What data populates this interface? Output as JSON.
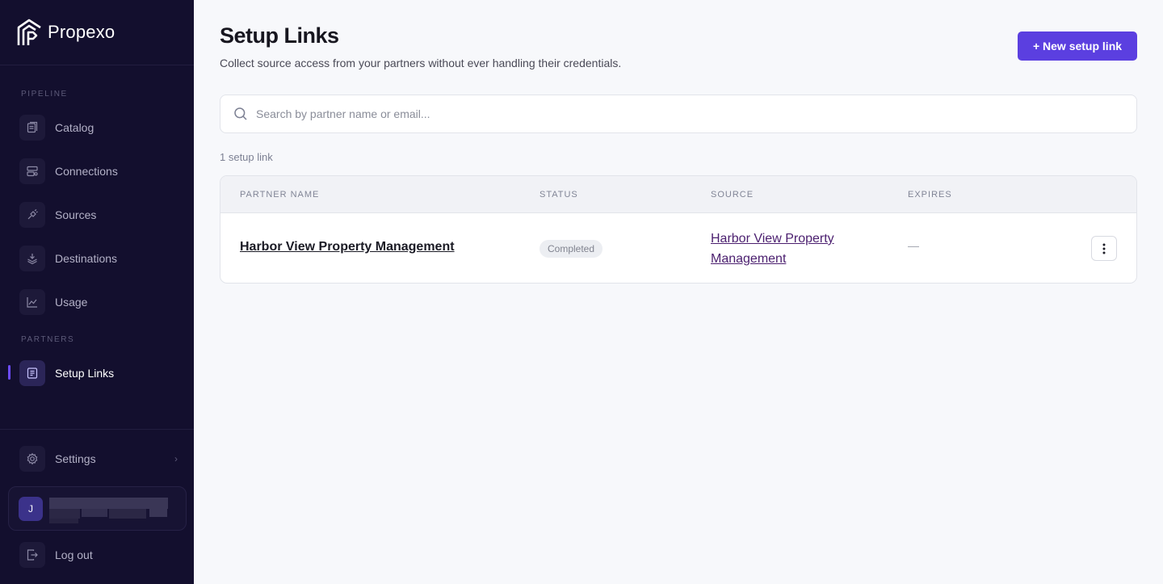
{
  "brand": {
    "name": "Propexo"
  },
  "sidebar": {
    "pipeline_label": "PIPELINE",
    "partners_label": "PARTNERS",
    "items": [
      {
        "label": "Catalog",
        "icon": "catalog-icon"
      },
      {
        "label": "Connections",
        "icon": "connections-icon"
      },
      {
        "label": "Sources",
        "icon": "sources-icon"
      },
      {
        "label": "Destinations",
        "icon": "destinations-icon"
      },
      {
        "label": "Usage",
        "icon": "usage-icon"
      },
      {
        "label": "Setup Links",
        "icon": "setup-links-icon",
        "active": true
      }
    ],
    "settings_label": "Settings",
    "logout_label": "Log out",
    "user_initial": "J"
  },
  "header": {
    "title": "Setup Links",
    "subtitle": "Collect source access from your partners without ever handling their credentials.",
    "new_button": "+ New setup link"
  },
  "search": {
    "placeholder": "Search by partner name or email..."
  },
  "count_text": "1 setup link",
  "table": {
    "columns": [
      "PARTNER NAME",
      "STATUS",
      "SOURCE",
      "EXPIRES"
    ],
    "rows": [
      {
        "partner": "Harbor View Property Management",
        "status": "Completed",
        "source": "Harbor View Property Management",
        "expires": "—"
      }
    ]
  },
  "colors": {
    "sidebar_bg": "#130f2e",
    "accent": "#5b3fe0",
    "link": "#4b1f6f"
  }
}
